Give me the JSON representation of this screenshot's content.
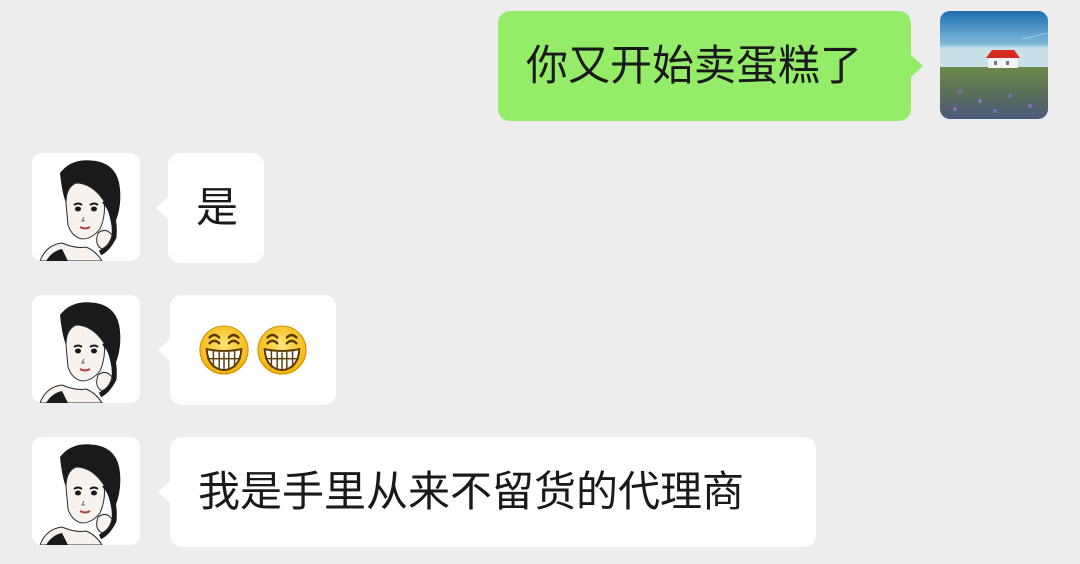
{
  "messages": [
    {
      "direction": "out",
      "text": "你又开始卖蛋糕了",
      "avatar": "landscape-avatar"
    },
    {
      "direction": "in",
      "text": "是",
      "avatar": "girl-avatar"
    },
    {
      "direction": "in",
      "emoji": [
        "grin-emoji",
        "grin-emoji"
      ],
      "avatar": "girl-avatar"
    },
    {
      "direction": "in",
      "text": "我是手里从来不留货的代理商",
      "avatar": "girl-avatar"
    }
  ],
  "colors": {
    "background": "#ededed",
    "outgoing_bubble": "#95ec69",
    "incoming_bubble": "#ffffff",
    "text": "#191919"
  }
}
